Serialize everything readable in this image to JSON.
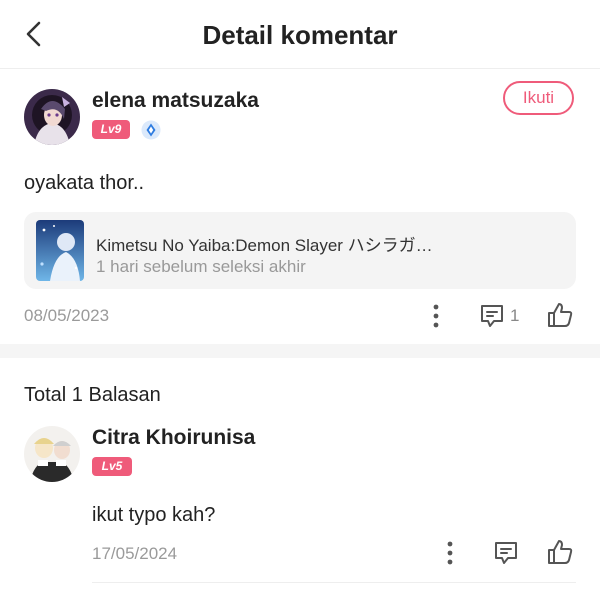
{
  "header": {
    "title": "Detail komentar"
  },
  "comment": {
    "username": "elena matsuzaka",
    "level": "Lv9",
    "follow_label": "Ikuti",
    "text": "oyakata thor..",
    "work": {
      "title": "Kimetsu No Yaiba:Demon Slayer ハシラガ…",
      "subtitle": "1 hari sebelum seleksi akhir"
    },
    "date": "08/05/2023",
    "reply_count": "1"
  },
  "replies": {
    "total_label": "Total 1 Balasan",
    "items": [
      {
        "username": "Citra Khoirunisa",
        "level": "Lv5",
        "text": "ikut typo kah?",
        "date": "17/05/2024"
      }
    ]
  },
  "colors": {
    "accent": "#ef5b7a",
    "muted": "#9a9a9a",
    "card_bg": "#f4f4f4",
    "badge_blue": "#2d7be0"
  },
  "icons": [
    "back-arrow-icon",
    "verified-gem-icon",
    "more-vertical-icon",
    "comment-icon",
    "thumbs-up-icon"
  ]
}
